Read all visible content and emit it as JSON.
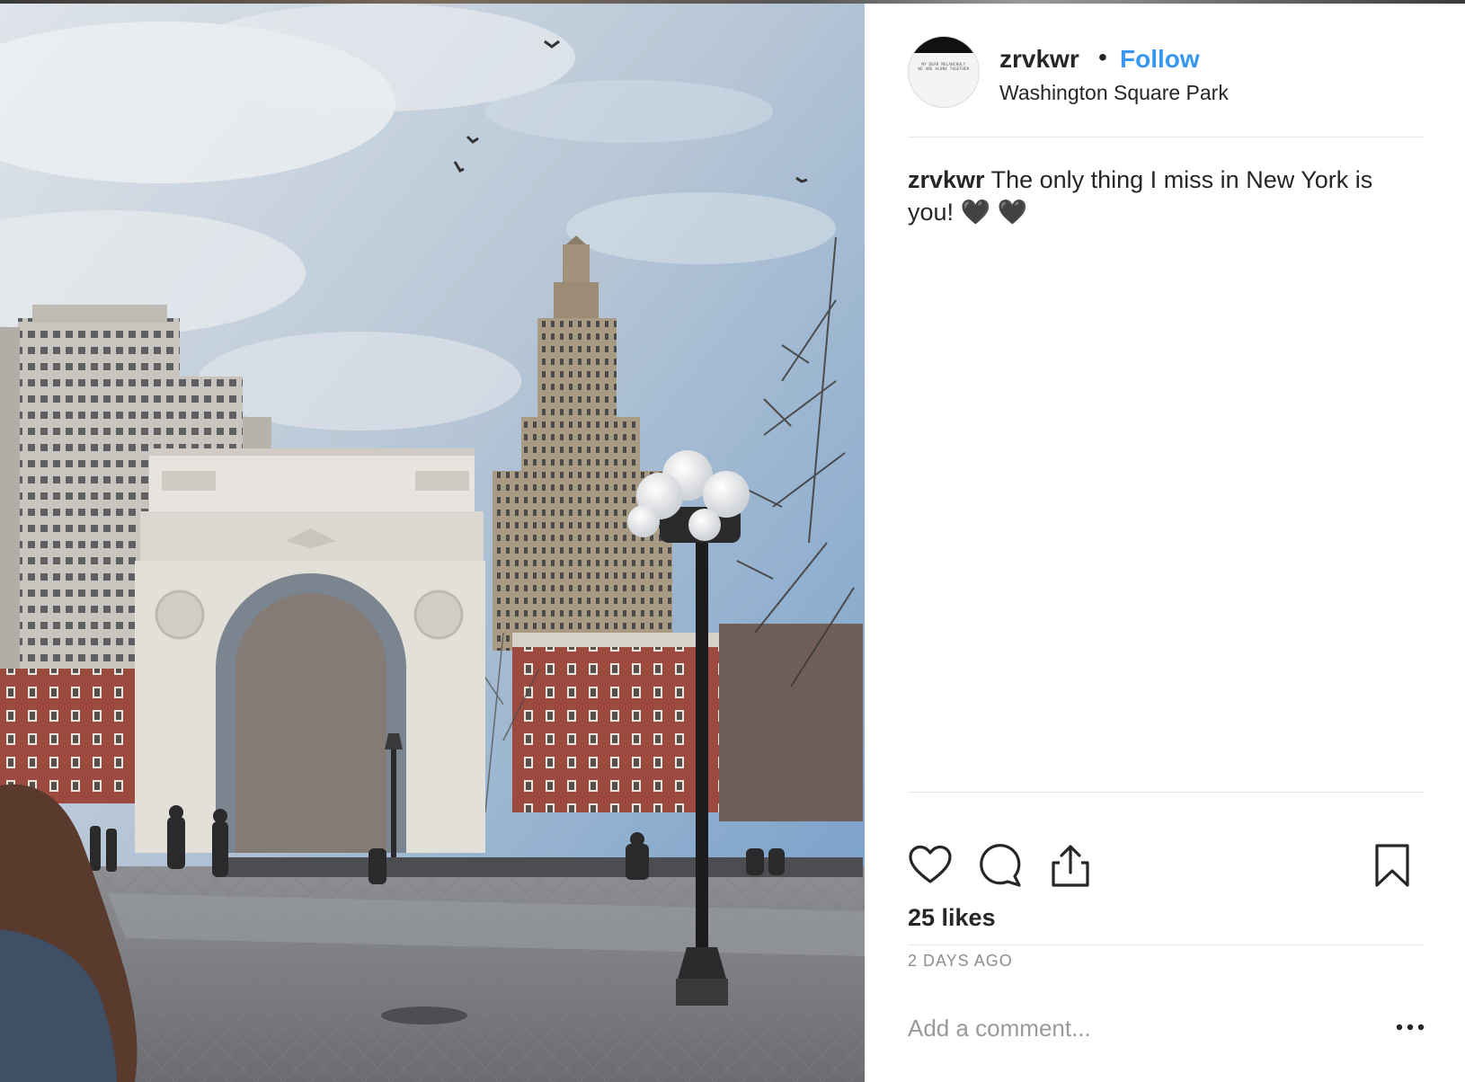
{
  "post": {
    "username": "zrvkwr",
    "separator": "•",
    "follow_label": "Follow",
    "location": "Washington Square Park",
    "avatar_text": [
      "MY DEAR MELANCHOLY",
      "WE ARE ALONE TOGETHER"
    ],
    "caption_user": "zrvkwr",
    "caption_text": " The only thing I miss in New York is you! 🖤 🖤",
    "likes": "25 likes",
    "timestamp": "2 DAYS AGO",
    "comment_placeholder": "Add a comment..."
  },
  "icons": {
    "like": "heart-icon",
    "comment": "comment-bubble-icon",
    "share": "share-icon",
    "save": "bookmark-icon",
    "more": "more-options-icon"
  },
  "colors": {
    "follow": "#3897f0",
    "text": "#262626",
    "muted": "#8e8e8e",
    "divider": "#e6e6e6"
  }
}
